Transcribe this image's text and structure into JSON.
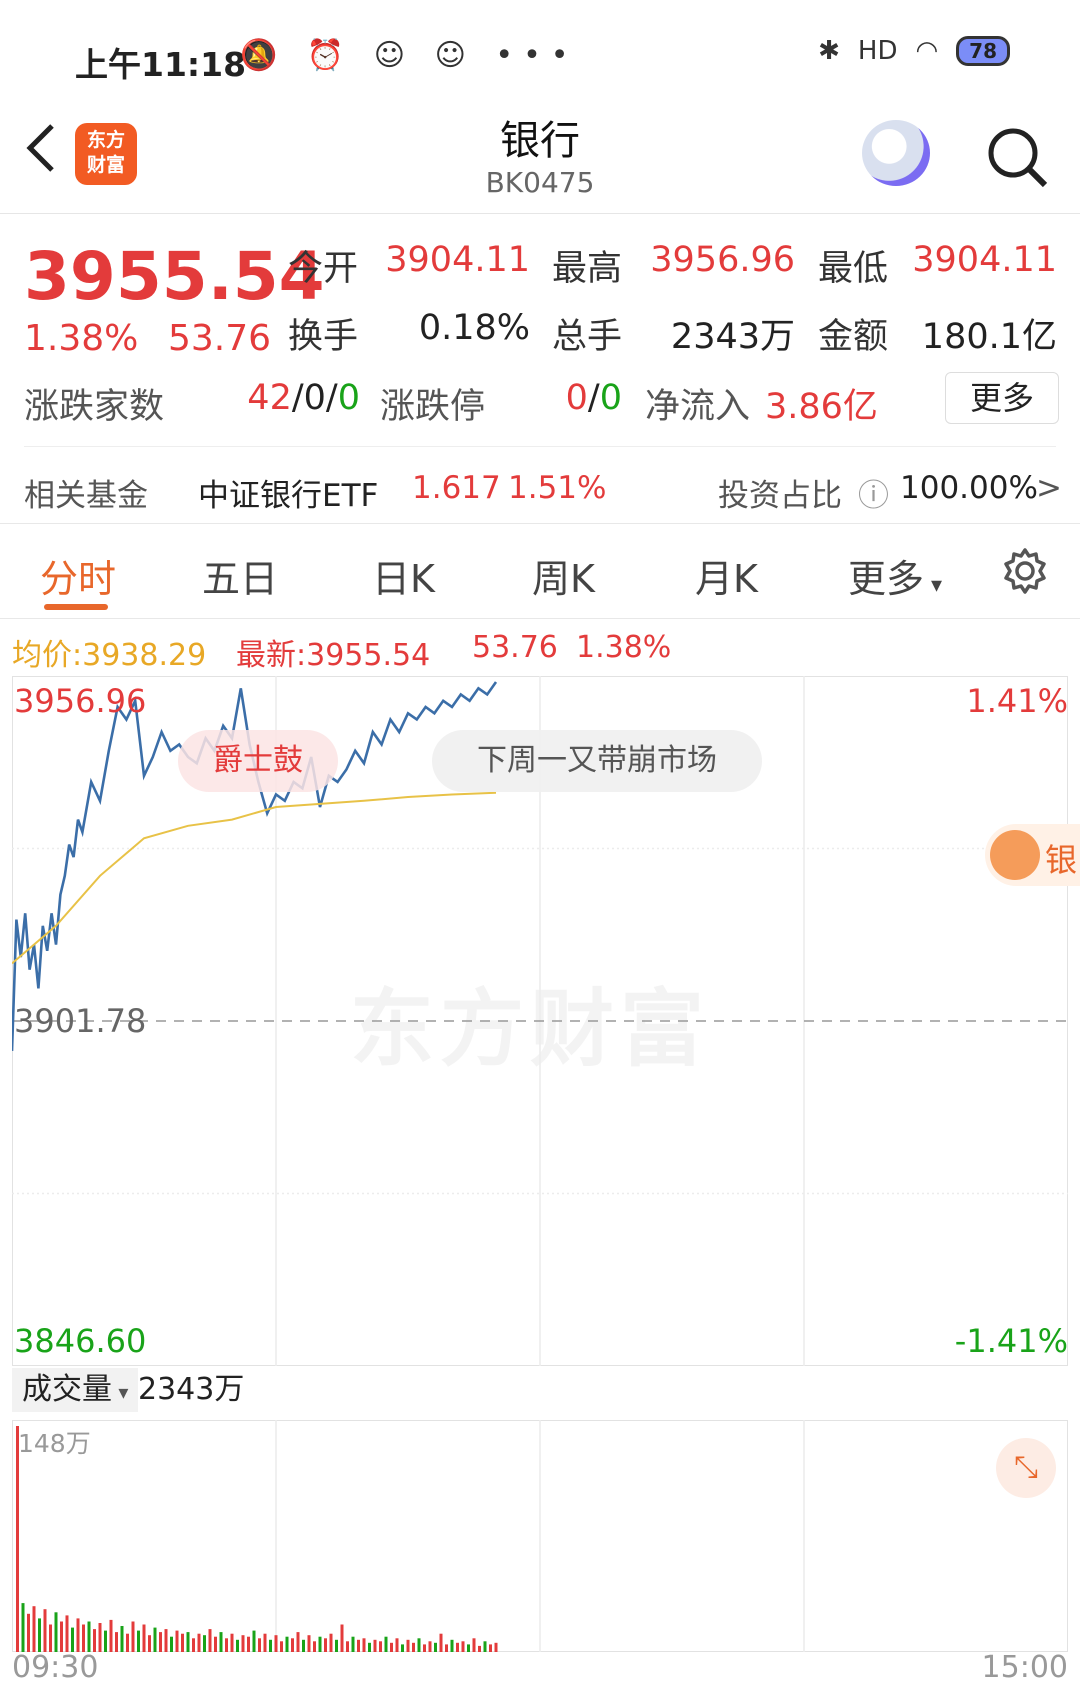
{
  "status_bar": {
    "time": "上午11:18",
    "icons": "🔕 ⏰ ☺ ☺ •••",
    "battery": "78",
    "signal": "HD"
  },
  "header": {
    "logo_line1": "东方",
    "logo_line2": "财富",
    "title": "银行",
    "code": "BK0475"
  },
  "quote": {
    "price": "3955.54",
    "change_pct": "1.38%",
    "change": "53.76",
    "open_label": "今开",
    "open": "3904.11",
    "high_label": "最高",
    "high": "3956.96",
    "low_label": "最低",
    "low": "3904.11",
    "turnover_label": "换手",
    "turnover": "0.18%",
    "volume_label": "总手",
    "volume": "2343万",
    "amount_label": "金额",
    "amount": "180.1亿",
    "breadth_label": "涨跌家数",
    "breadth_up": "42",
    "breadth_flat": "0",
    "breadth_down": "0",
    "limit_label": "涨跌停",
    "limit_up": "0",
    "limit_down": "0",
    "inflow_label": "净流入",
    "inflow": "3.86亿",
    "more_label": "更多"
  },
  "fund": {
    "label": "相关基金",
    "name": "中证银行ETF",
    "price": "1.617",
    "pct": "1.51%",
    "ratio_label": "投资占比",
    "ratio": "100.00%"
  },
  "tabs": [
    "分时",
    "五日",
    "日K",
    "周K",
    "月K",
    "更多"
  ],
  "info_line": {
    "avg_label": "均价:",
    "avg": "3938.29",
    "latest_label": "最新:",
    "latest": "3955.54",
    "change": "53.76",
    "pct": "1.38%"
  },
  "chart_labels": {
    "top": "3956.96",
    "mid": "3901.78",
    "bottom": "3846.60",
    "top_pct": "1.41%",
    "bottom_pct": "-1.41%"
  },
  "danmaku": [
    "爵士鼓",
    "下周一又带崩市场"
  ],
  "mascot_text": "银",
  "watermark": "东方财富",
  "volume": {
    "label": "成交量",
    "total": "2343万",
    "max_label": "148万"
  },
  "time_axis": {
    "start": "09:30",
    "end": "15:00"
  },
  "colors": {
    "up": "#e33b3b",
    "down": "#19a319",
    "price_line": "#3b6ea8",
    "avg_line": "#e8c247",
    "accent": "#e8672b"
  },
  "chart_data": {
    "type": "line",
    "title": "",
    "xlabel": "",
    "ylabel": "",
    "ylim": [
      3846.6,
      3956.96
    ],
    "base": 3901.78,
    "xlim_minutes": [
      0,
      240
    ],
    "series": [
      {
        "x": [
          0,
          1,
          2,
          3,
          4,
          5,
          6,
          7,
          8,
          9,
          10,
          11,
          12,
          13,
          14,
          15,
          16,
          18,
          20,
          22,
          24,
          26,
          28,
          30,
          32,
          34,
          36,
          38,
          40,
          42,
          44,
          46,
          48,
          50,
          52,
          54,
          56,
          58,
          60,
          62,
          64,
          66,
          68,
          70,
          72,
          74,
          76,
          78,
          80,
          82,
          84,
          86,
          88,
          90,
          92,
          94,
          96,
          98,
          100,
          102,
          104,
          106,
          108,
          110
        ],
        "values": [
          3897,
          3918,
          3912,
          3919,
          3910,
          3914,
          3907,
          3917,
          3913,
          3919,
          3914,
          3922,
          3925,
          3930,
          3928,
          3934,
          3932,
          3940,
          3937,
          3945,
          3952,
          3950,
          3953,
          3941,
          3944,
          3948,
          3945,
          3946,
          3944,
          3943,
          3947,
          3945,
          3949,
          3947,
          3955,
          3946,
          3940,
          3935,
          3938,
          3937,
          3940,
          3939,
          3944,
          3936,
          3941,
          3940,
          3942,
          3945,
          3943,
          3948,
          3946,
          3950,
          3948,
          3951,
          3950,
          3952,
          3951,
          3953,
          3952,
          3954,
          3953,
          3955,
          3954,
          3956
        ]
      },
      {
        "x": [
          0,
          10,
          20,
          30,
          40,
          50,
          60,
          70,
          80,
          90,
          100,
          110
        ],
        "values": [
          3911,
          3917,
          3925,
          3931,
          3933,
          3934,
          3936,
          3936.5,
          3937,
          3937.6,
          3938,
          3938.3
        ]
      }
    ],
    "volume_values": [
      148,
      32,
      25,
      30,
      22,
      28,
      18,
      26,
      20,
      24,
      16,
      22,
      18,
      20,
      15,
      19,
      14,
      21,
      13,
      17,
      12,
      20,
      14,
      18,
      11,
      16,
      13,
      15,
      10,
      14,
      12,
      13,
      9,
      12,
      11,
      15,
      10,
      13,
      9,
      12,
      8,
      11,
      10,
      14,
      9,
      12,
      8,
      11,
      7,
      10,
      9,
      13,
      8,
      11,
      7,
      10,
      9,
      12,
      8,
      18,
      7,
      10,
      8,
      9,
      6,
      8,
      7,
      10,
      6,
      9,
      5,
      8,
      6,
      9,
      5,
      7,
      6,
      12,
      5,
      8,
      6,
      7,
      5,
      9,
      4,
      7,
      5,
      6
    ]
  }
}
